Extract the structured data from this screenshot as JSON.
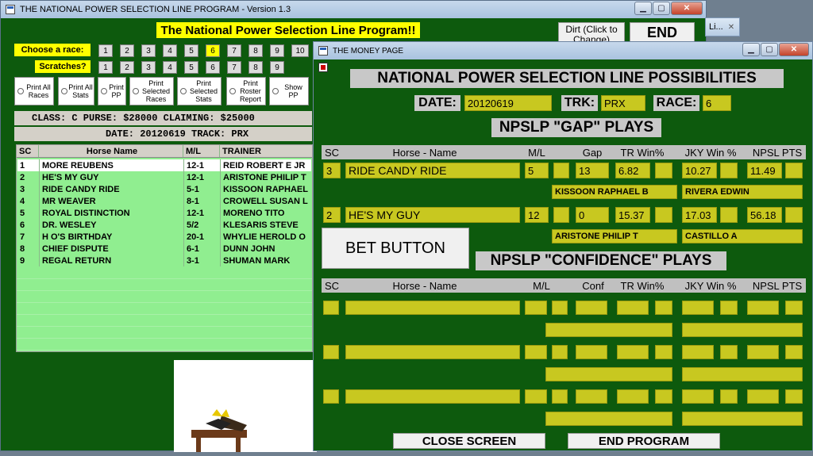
{
  "main_window": {
    "title": "THE NATIONAL POWER SELECTION LINE PROGRAM - Version 1.3",
    "banner": "The National Power Selection Line Program!!",
    "choose_label": "Choose  a race:",
    "scratches_label": "Scratches?",
    "race_numbers": [
      "1",
      "2",
      "3",
      "4",
      "5",
      "6",
      "7",
      "8",
      "9",
      "10"
    ],
    "scratch_numbers": [
      "1",
      "2",
      "3",
      "4",
      "5",
      "6",
      "7",
      "8",
      "9"
    ],
    "selected_race": "6",
    "options": [
      {
        "label": "Print All Races"
      },
      {
        "label": "Print All Stats"
      },
      {
        "label": "Print PP"
      },
      {
        "label": "Print Selected Races"
      },
      {
        "label": "Print Selected Stats"
      },
      {
        "label": "Print Roster Report"
      },
      {
        "label": "Show PP"
      }
    ],
    "dirt_button": "Dirt (Click to Change)",
    "end_button": "END",
    "class_line": "CLASS: C    PURSE: $28000   CLAIMING: $25000",
    "date_line": "DATE: 20120619   TRACK: PRX",
    "grid_headers": {
      "sc": "SC",
      "name": "Horse Name",
      "ml": "M/L",
      "trainer": "TRAINER"
    },
    "horses": [
      {
        "sc": "1",
        "name": "MORE REUBENS",
        "ml": "12-1",
        "trainer": "REID ROBERT E JR"
      },
      {
        "sc": "2",
        "name": "HE'S MY GUY",
        "ml": "12-1",
        "trainer": "ARISTONE PHILIP T"
      },
      {
        "sc": "3",
        "name": "RIDE CANDY RIDE",
        "ml": "5-1",
        "trainer": "KISSOON RAPHAEL"
      },
      {
        "sc": "4",
        "name": "MR WEAVER",
        "ml": "8-1",
        "trainer": "CROWELL SUSAN L"
      },
      {
        "sc": "5",
        "name": "ROYAL DISTINCTION",
        "ml": "12-1",
        "trainer": "MORENO TITO"
      },
      {
        "sc": "6",
        "name": "DR. WESLEY",
        "ml": "5/2",
        "trainer": "KLESARIS STEVE"
      },
      {
        "sc": "7",
        "name": "H O'S BIRTHDAY",
        "ml": "20-1",
        "trainer": "WHYLIE HEROLD O"
      },
      {
        "sc": "8",
        "name": "CHIEF DISPUTE",
        "ml": "6-1",
        "trainer": "DUNN JOHN"
      },
      {
        "sc": "9",
        "name": "REGAL RETURN",
        "ml": "3-1",
        "trainer": "SHUMAN MARK"
      }
    ]
  },
  "taskbar_tab": {
    "label": "Li...",
    "close": "✕"
  },
  "money_window": {
    "title": "THE MONEY PAGE",
    "heading": "NATIONAL POWER SELECTION LINE POSSIBILITIES",
    "date_label": "DATE:",
    "date_value": "20120619",
    "trk_label": "TRK:",
    "trk_value": "PRX",
    "race_label": "RACE:",
    "race_value": "6",
    "gap_heading": "NPSLP \"GAP\" PLAYS",
    "gap_headers": {
      "sc": "SC",
      "name": "Horse - Name",
      "ml": "M/L",
      "gap": "Gap",
      "tr": "TR Win%",
      "jky": "JKY Win %",
      "npsl": "NPSL PTS"
    },
    "gap_plays": [
      {
        "sc": "3",
        "name": "RIDE CANDY RIDE",
        "ml": "5",
        "gap": "13",
        "tr": "6.82",
        "jky": "10.27",
        "npsl": "11.49",
        "trainer": "KISSOON RAPHAEL B",
        "jockey": "RIVERA EDWIN"
      },
      {
        "sc": "2",
        "name": "HE'S MY GUY",
        "ml": "12",
        "gap": "0",
        "tr": "15.37",
        "jky": "17.03",
        "npsl": "56.18",
        "trainer": "ARISTONE PHILIP T",
        "jockey": "CASTILLO A"
      }
    ],
    "bet_button": "BET BUTTON",
    "conf_heading": "NPSLP \"CONFIDENCE\" PLAYS",
    "conf_headers": {
      "sc": "SC",
      "name": "Horse - Name",
      "ml": "M/L",
      "conf": "Conf",
      "tr": "TR Win%",
      "jky": "JKY Win %",
      "npsl": "NPSL PTS"
    },
    "close_button": "CLOSE SCREEN",
    "end_program_button": "END PROGRAM"
  },
  "colors": {
    "accent_yellow": "#ffff00",
    "field_olive": "#c8c820",
    "window_green": "#0d5a0d",
    "grid_green": "#90ee90"
  }
}
